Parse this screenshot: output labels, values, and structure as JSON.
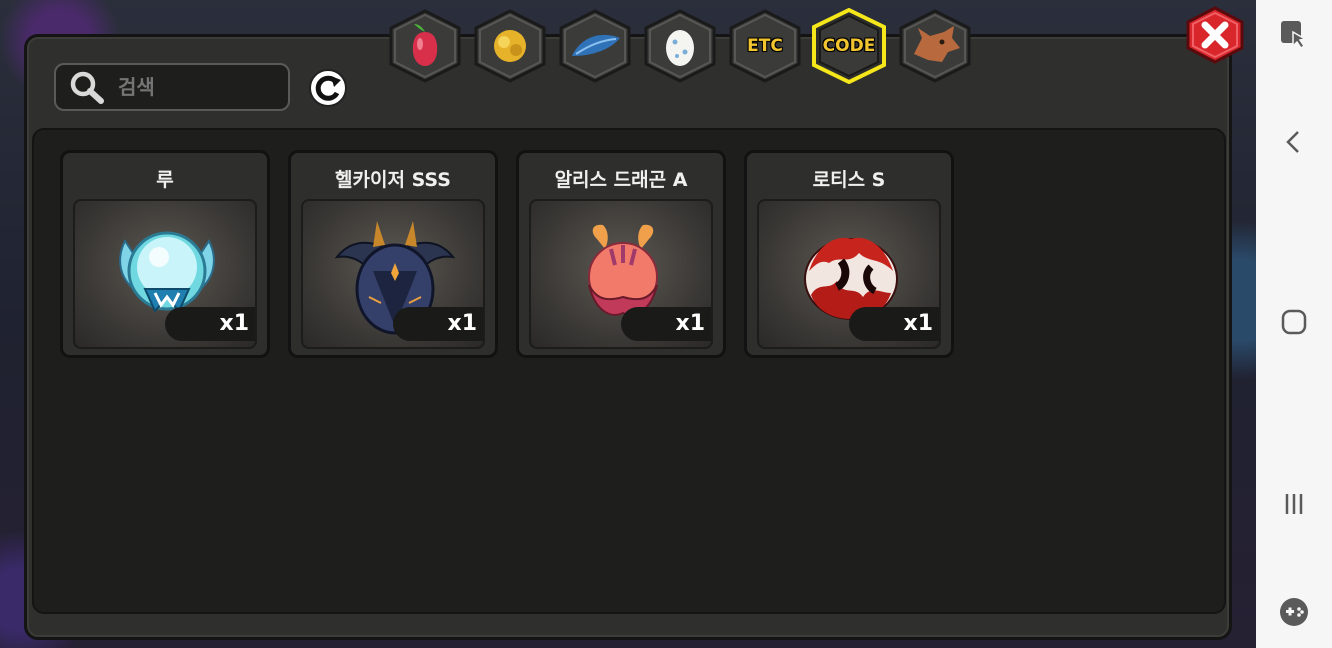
{
  "search": {
    "placeholder": "검색",
    "value": "검색"
  },
  "tabs": [
    {
      "id": "fruit",
      "label": "",
      "icon": "fruit-icon"
    },
    {
      "id": "gold",
      "label": "",
      "icon": "gold-icon"
    },
    {
      "id": "feather",
      "label": "",
      "icon": "feather-icon"
    },
    {
      "id": "egg",
      "label": "",
      "icon": "egg-icon"
    },
    {
      "id": "etc",
      "label": "ETC",
      "icon": ""
    },
    {
      "id": "code",
      "label": "CODE",
      "icon": "",
      "selected": true
    },
    {
      "id": "dragon",
      "label": "",
      "icon": "dragon-head-icon"
    }
  ],
  "items": [
    {
      "name": "루",
      "quantity": "x1",
      "icon": "blue-winged-egg-icon"
    },
    {
      "name": "헬카이저 SSS",
      "quantity": "x1",
      "icon": "dark-armored-egg-icon"
    },
    {
      "name": "알리스 드래곤 A",
      "quantity": "x1",
      "icon": "pink-horned-egg-icon"
    },
    {
      "name": "로티스 S",
      "quantity": "x1",
      "icon": "red-spotted-egg-icon"
    }
  ],
  "colors": {
    "accent_selected": "#f5e71a",
    "tab_label": "#f2c530",
    "close_red": "#d8262b"
  },
  "system_nav": [
    "screen-capture-icon",
    "back-icon",
    "home-icon",
    "recents-icon",
    "game-tools-icon"
  ]
}
